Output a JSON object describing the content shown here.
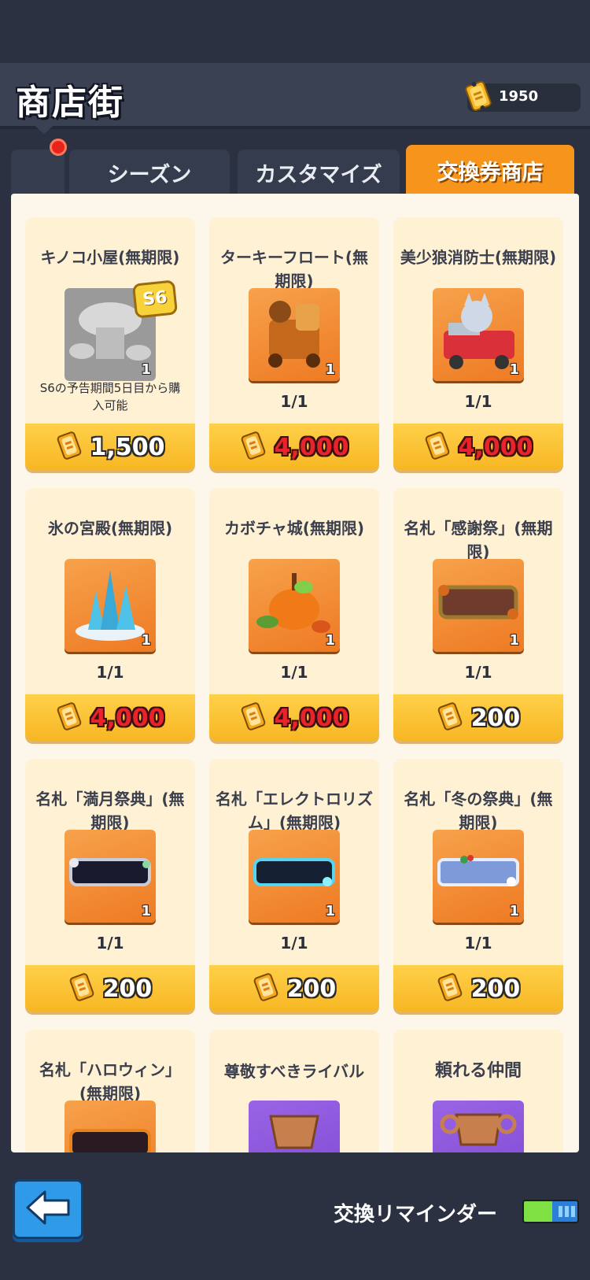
{
  "header": {
    "title": "商店街",
    "currency_value": "1950"
  },
  "tabs": [
    {
      "label": "シーズン",
      "active": false
    },
    {
      "label": "カスタマイズ",
      "active": false
    },
    {
      "label": "交換券商店",
      "active": true
    }
  ],
  "items": [
    {
      "name": "キノコ小屋(無期限)",
      "qty": "1",
      "badge": "S6",
      "note": "S6の予告期間5日目から購入可能",
      "price": "1,500",
      "price_color": "white"
    },
    {
      "name": "ターキーフロート(無期限)",
      "qty": "1",
      "stock": "1/1",
      "price": "4,000",
      "price_color": "red"
    },
    {
      "name": "美少狼消防士(無期限)",
      "qty": "1",
      "stock": "1/1",
      "price": "4,000",
      "price_color": "red"
    },
    {
      "name": "氷の宮殿(無期限)",
      "qty": "1",
      "stock": "1/1",
      "price": "4,000",
      "price_color": "red"
    },
    {
      "name": "カボチャ城(無期限)",
      "qty": "1",
      "stock": "1/1",
      "price": "4,000",
      "price_color": "red"
    },
    {
      "name": "名札「感謝祭」(無期限)",
      "qty": "1",
      "stock": "1/1",
      "price": "200",
      "price_color": "white"
    },
    {
      "name": "名札「満月祭典」(無期限)",
      "qty": "1",
      "stock": "1/1",
      "price": "200",
      "price_color": "white"
    },
    {
      "name": "名札「エレクトロリズム」(無期限)",
      "qty": "1",
      "stock": "1/1",
      "price": "200",
      "price_color": "white"
    },
    {
      "name": "名札「冬の祭典」(無期限)",
      "qty": "1",
      "stock": "1/1",
      "price": "200",
      "price_color": "white"
    },
    {
      "name": "名札「ハロウィン」(無期限)"
    },
    {
      "name": "尊敬すべきライバル"
    },
    {
      "name": "頼れる仲間"
    }
  ],
  "footer": {
    "reminder_label": "交換リマインダー",
    "reminder_on": true
  }
}
